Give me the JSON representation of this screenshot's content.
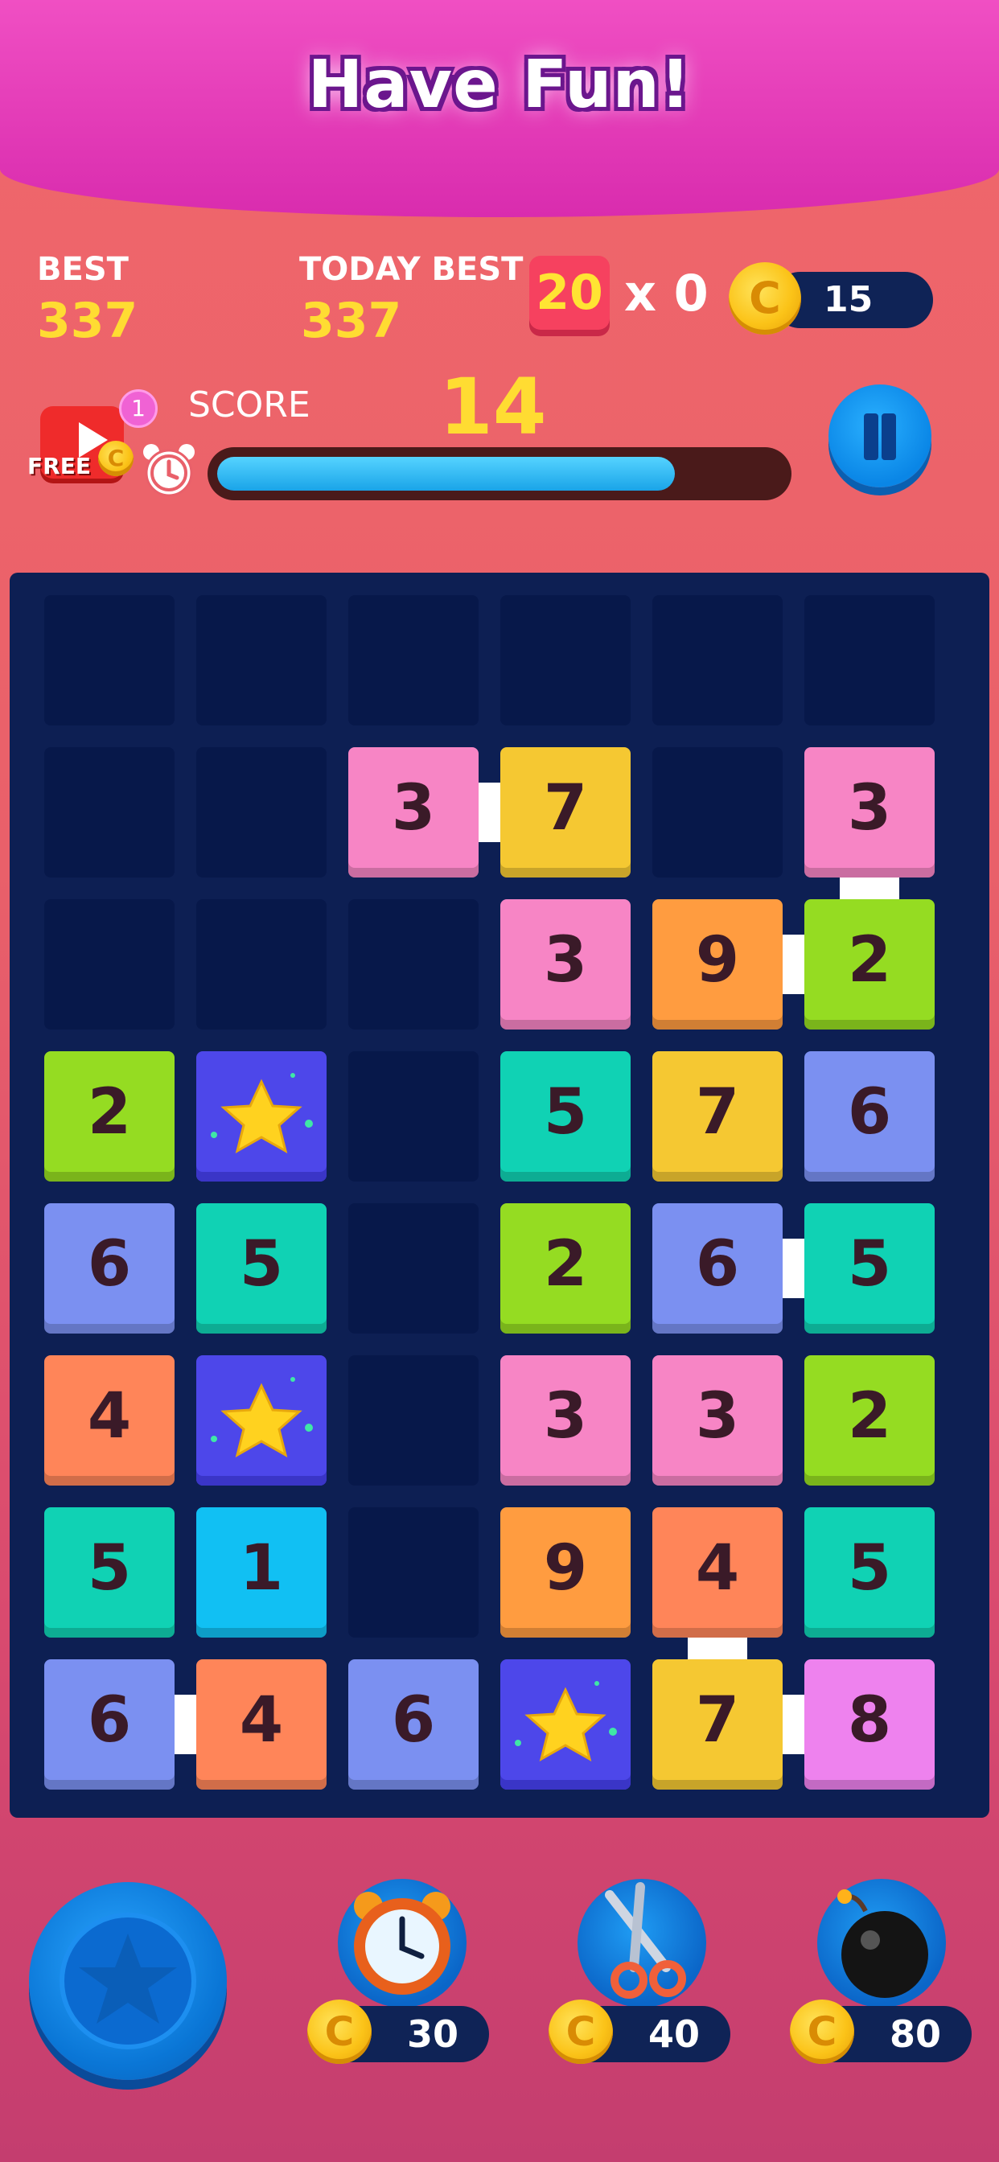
{
  "header": {
    "title": "Have Fun!"
  },
  "stats": {
    "best_label": "BEST",
    "best_value": "337",
    "today_label": "TODAY BEST",
    "today_value": "337",
    "combo_value": "20",
    "combo_multiplier": "x 0",
    "coins": "15",
    "coin_symbol": "C"
  },
  "score": {
    "label": "SCORE",
    "value": "14",
    "time_progress": 0.81
  },
  "free_video": {
    "label": "FREE",
    "badge": "1"
  },
  "colors": {
    "pink": "#f785c5",
    "yellow": "#f5c832",
    "orange": "#ff9c40",
    "green": "#95dc22",
    "teal": "#10d2b4",
    "blue": "#7b90f1",
    "red_orange": "#ff8559",
    "cyan": "#11c0f3",
    "violet": "#ee82ee",
    "star": "#4d47ea"
  },
  "board": {
    "rows": [
      [
        null,
        null,
        null,
        null,
        null,
        null
      ],
      [
        null,
        null,
        {
          "v": "3",
          "c": "pink"
        },
        {
          "v": "7",
          "c": "yellow"
        },
        null,
        {
          "v": "3",
          "c": "pink"
        }
      ],
      [
        null,
        null,
        null,
        {
          "v": "3",
          "c": "pink"
        },
        {
          "v": "9",
          "c": "orange"
        },
        {
          "v": "2",
          "c": "green"
        }
      ],
      [
        {
          "v": "2",
          "c": "green"
        },
        {
          "v": "",
          "c": "star"
        },
        null,
        {
          "v": "5",
          "c": "teal"
        },
        {
          "v": "7",
          "c": "yellow"
        },
        {
          "v": "6",
          "c": "blue"
        }
      ],
      [
        {
          "v": "6",
          "c": "blue"
        },
        {
          "v": "5",
          "c": "teal"
        },
        null,
        {
          "v": "2",
          "c": "green"
        },
        {
          "v": "6",
          "c": "blue"
        },
        {
          "v": "5",
          "c": "teal"
        }
      ],
      [
        {
          "v": "4",
          "c": "red_orange"
        },
        {
          "v": "",
          "c": "star"
        },
        null,
        {
          "v": "3",
          "c": "pink"
        },
        {
          "v": "3",
          "c": "pink"
        },
        {
          "v": "2",
          "c": "green"
        }
      ],
      [
        {
          "v": "5",
          "c": "teal"
        },
        {
          "v": "1",
          "c": "cyan"
        },
        null,
        {
          "v": "9",
          "c": "orange"
        },
        {
          "v": "4",
          "c": "red_orange"
        },
        {
          "v": "5",
          "c": "teal"
        }
      ],
      [
        {
          "v": "6",
          "c": "blue"
        },
        {
          "v": "4",
          "c": "red_orange"
        },
        {
          "v": "6",
          "c": "blue"
        },
        {
          "v": "",
          "c": "star"
        },
        {
          "v": "7",
          "c": "yellow"
        },
        {
          "v": "8",
          "c": "violet"
        }
      ]
    ],
    "connectors": [
      {
        "r": 1,
        "c": 2,
        "dir": "h"
      },
      {
        "r": 1,
        "c": 5,
        "dir": "v"
      },
      {
        "r": 2,
        "c": 4,
        "dir": "h"
      },
      {
        "r": 4,
        "c": 4,
        "dir": "h"
      },
      {
        "r": 6,
        "c": 4,
        "dir": "v"
      },
      {
        "r": 7,
        "c": 0,
        "dir": "h"
      },
      {
        "r": 7,
        "c": 4,
        "dir": "h"
      }
    ]
  },
  "powerups": [
    {
      "name": "clock-powerup",
      "price": "30"
    },
    {
      "name": "scissors-powerup",
      "price": "40"
    },
    {
      "name": "bomb-powerup",
      "price": "80"
    }
  ]
}
